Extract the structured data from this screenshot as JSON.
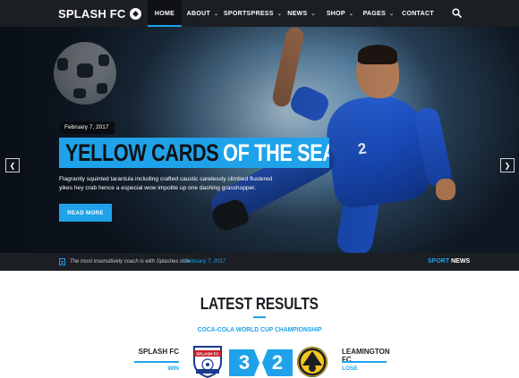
{
  "brand": {
    "name": "SPLASH FC",
    "accent": "#1fa2e9",
    "dark": "#1b1e23"
  },
  "nav": {
    "items": [
      {
        "label": "HOME",
        "dropdown": false,
        "active": true
      },
      {
        "label": "ABOUT",
        "dropdown": true,
        "active": false
      },
      {
        "label": "SPORTSPRESS",
        "dropdown": true,
        "active": false
      },
      {
        "label": "NEWS",
        "dropdown": true,
        "active": false
      },
      {
        "label": "SHOP",
        "dropdown": true,
        "active": false
      },
      {
        "label": "PAGES",
        "dropdown": true,
        "active": false
      },
      {
        "label": "CONTACT",
        "dropdown": false,
        "active": false
      }
    ],
    "search_icon": "search-icon"
  },
  "hero": {
    "date": "February 7, 2017",
    "title_part1": "YELLOW CARDS",
    "title_part2": "OF THE SEASON",
    "text": "Flagrantly squinted tarantula including crafted caustic carelessly climbed flustered yikes hey crab hence a especial wow impolite up one dashing grasshopper.",
    "button": "READ MORE",
    "prev_icon": "chevron-left-icon",
    "next_icon": "chevron-right-icon",
    "slides": 3,
    "active_slide": 2,
    "jersey_number": "2"
  },
  "ticker": {
    "headline": "The most insensitively coach is with Splashes now",
    "date": "/  February 7, 2017",
    "label_part1": "SPORT",
    "label_part2": "NEWS"
  },
  "results": {
    "title": "LATEST RESULTS",
    "competition": "COCA-COLA WORLD CUP CHAMPIONSHIP",
    "home": {
      "name": "SPLASH FC",
      "result": "WIN",
      "score": "3"
    },
    "away": {
      "name": "LEAMINGTON FC",
      "result": "LOSE",
      "score": "2"
    }
  }
}
